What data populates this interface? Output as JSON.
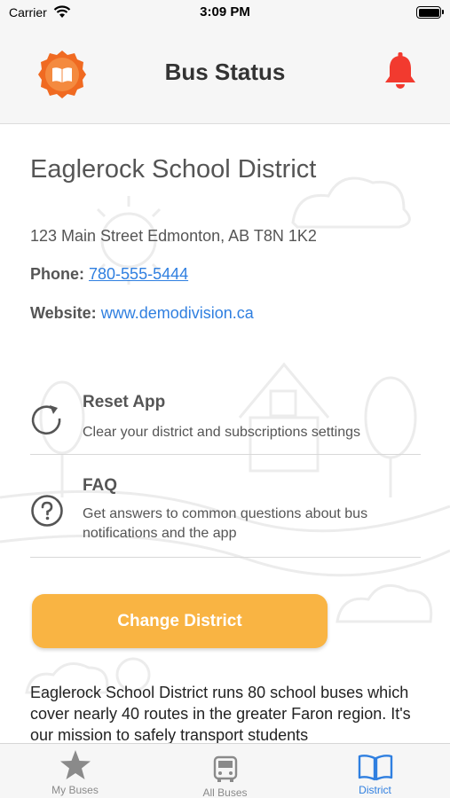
{
  "status_bar": {
    "carrier": "Carrier",
    "time": "3:09 PM",
    "icons": [
      "wifi-icon",
      "battery-icon"
    ]
  },
  "nav": {
    "title": "Bus Status",
    "left_icon": "book-badge-icon",
    "right_icon": "bell-icon",
    "brand_color": "#f06a21",
    "bell_color": "#f23a2f"
  },
  "district": {
    "name": "Eaglerock School District",
    "address": "123 Main Street Edmonton, AB T8N 1K2",
    "phone_label": "Phone:",
    "phone": "780-555-5444",
    "website_label": "Website:",
    "website": "www.demodivision.ca"
  },
  "actions": [
    {
      "title": "Reset App",
      "description": "Clear your district and subscriptions settings",
      "icon": "refresh-icon"
    },
    {
      "title": "FAQ",
      "description": "Get answers to common questions about bus notifications and the app",
      "icon": "question-icon"
    }
  ],
  "change_button": {
    "label": "Change District",
    "color": "#f9b443"
  },
  "description": "Eaglerock School District runs 80 school buses which cover nearly 40 routes in the greater Faron region. It's our mission to safely transport students",
  "tabs": [
    {
      "label": "My Buses",
      "icon": "star-icon",
      "active": false
    },
    {
      "label": "All Buses",
      "icon": "bus-icon",
      "active": false
    },
    {
      "label": "District",
      "icon": "book-icon",
      "active": true
    }
  ],
  "colors": {
    "link": "#2f7fe0",
    "accent_active": "#2f7fe0"
  }
}
